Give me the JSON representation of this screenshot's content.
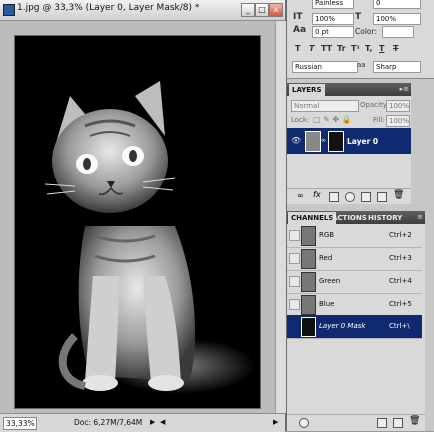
{
  "window": {
    "title": "1.jpg @ 33,3% (Layer 0, Layer Mask/8) *",
    "buttons": {
      "minimize": "_",
      "restore": "□",
      "close": "×"
    }
  },
  "status": {
    "zoom": "33,33%",
    "doc": "Doc: 6,27M/7,64M"
  },
  "character": {
    "top_field": "Painless",
    "top_field2": "0",
    "scale_v": "100%",
    "scale_h": "100%",
    "baseline": "0 pt",
    "color_label": "Color:",
    "language": "Russian",
    "antialias": "Sharp",
    "style_buttons": [
      "T",
      "T",
      "TT",
      "Tr",
      "T¹",
      "T,",
      "T",
      "T"
    ]
  },
  "layers": {
    "tab": "LAYERS",
    "blend_mode": "Normal",
    "opacity_label": "Opacity:",
    "opacity": "100%",
    "lock_label": "Lock:",
    "fill_label": "Fill:",
    "fill": "100%",
    "layer_name": "Layer 0"
  },
  "channels": {
    "tabs": [
      "CHANNELS",
      "ACTIONS",
      "HISTORY"
    ],
    "rows": [
      {
        "name": "RGB",
        "key": "Ctrl+2"
      },
      {
        "name": "Red",
        "key": "Ctrl+3"
      },
      {
        "name": "Green",
        "key": "Ctrl+4"
      },
      {
        "name": "Blue",
        "key": "Ctrl+5"
      },
      {
        "name": "Layer 0 Mask",
        "key": "Ctrl+\\"
      }
    ]
  },
  "icons": {
    "eye": "eye-icon",
    "chain": "chain-link-icon",
    "trash": "trash-icon",
    "new": "new-item-icon"
  },
  "colors": {
    "selection": "#0f2a6e",
    "panel_header": "#4a4a4a"
  }
}
